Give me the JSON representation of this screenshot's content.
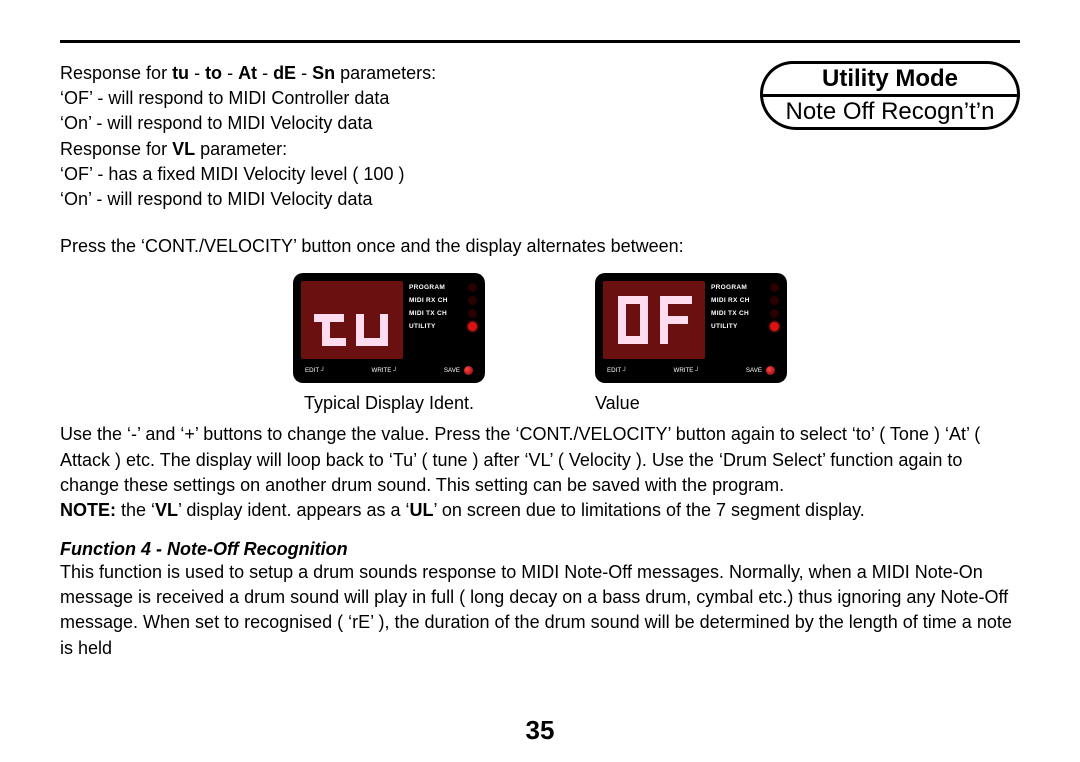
{
  "title_pill": {
    "top": "Utility Mode",
    "bottom": "Note Off Recogn’t’n"
  },
  "param_block": {
    "l1_a": "Response for  ",
    "l1_b": "tu",
    "l1_c": " - ",
    "l1_d": "to",
    "l1_e": " - ",
    "l1_f": "At",
    "l1_g": " - ",
    "l1_h": "dE",
    "l1_i": " - ",
    "l1_j": "Sn",
    "l1_k": " parameters:",
    "l2": "‘OF’ - will respond to MIDI Controller data",
    "l3": "‘On’ - will respond to MIDI Velocity data",
    "l4_a": "Response for ",
    "l4_b": "VL",
    "l4_c": " parameter:",
    "l5": "‘OF’ - has a fixed MIDI Velocity level ( 100 )",
    "l6": "‘On’ - will respond to MIDI Velocity data"
  },
  "press_line": "Press the ‘CONT./VELOCITY’ button once and the display alternates between:",
  "display_labels": {
    "program": "PROGRAM",
    "midi_rx": "MIDI RX CH",
    "midi_tx": "MIDI TX CH",
    "utility": "UTILITY",
    "edit": "EDIT ┘",
    "write": "WRITE ┘",
    "save": "SAVE"
  },
  "captions": {
    "left": "Typical Display Ident.",
    "right": "Value"
  },
  "para2_a": "Use the ‘-’ and ‘+’ buttons to change the value. Press the ‘CONT./VELOCITY’ button again to select ‘to’ ( Tone ) ‘At’ ( Attack ) etc. The display will loop back to ‘Tu’ ( tune ) after ‘VL’ ( Velocity ). Use the ‘Drum Select’ function again to change these settings on another drum sound. This setting can be saved with the program.",
  "note_lead": "NOTE:",
  "note_a": " the ‘",
  "note_b": "VL",
  "note_c": "’ display ident. appears as a ‘",
  "note_d": "UL",
  "note_e": "’ on screen due to limitations of the 7 segment display.",
  "func4_heading": "Function 4 - Note-Off Recognition",
  "func4_body": "This function is used to setup a drum sounds response to MIDI Note-Off messages. Normally, when a MIDI Note-On message is received a drum sound will play in full ( long decay on a bass drum, cymbal etc.) thus ignoring any Note-Off message. When set to recognised ( ‘rE’ ), the duration of the drum sound will be determined by the length of time a note is held",
  "page_number": "35"
}
